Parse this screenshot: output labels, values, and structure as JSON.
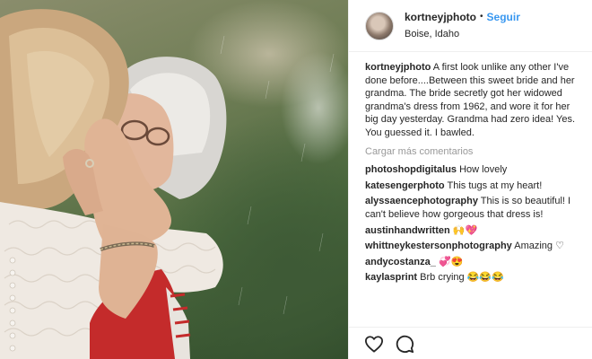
{
  "post": {
    "username": "kortneyjphoto",
    "separator": "•",
    "follow_label": "Seguir",
    "location": "Boise, Idaho",
    "caption_user": "kortneyjphoto",
    "caption_text": "A first look unlike any other I've done before....Between this sweet bride and her grandma. The bride secretly got her widowed grandma's dress from 1962, and wore it for her big day yesterday. Grandma had zero idea! Yes. You guessed it. I bawled.",
    "load_more_label": "Cargar más comentarios"
  },
  "comments": [
    {
      "user": "photoshopdigitalus",
      "text": "How lovely"
    },
    {
      "user": "katesengerphoto",
      "text": "This tugs at my heart!"
    },
    {
      "user": "alyssaencephotography",
      "text": "This is so beautiful! I can't believe how gorgeous that dress is!"
    },
    {
      "user": "austinhandwritten",
      "text": "🙌💖"
    },
    {
      "user": "whittneykestersonphotography",
      "text": "Amazing ♡"
    },
    {
      "user": "andycostanza_",
      "text": "💞😍"
    },
    {
      "user": "kaylasprint",
      "text": "Brb crying 😂😂😂"
    }
  ],
  "icons": {
    "like": "heart-icon",
    "comment": "comment-bubble-icon"
  },
  "colors": {
    "link": "#3897f0",
    "muted": "#999999",
    "text": "#262626"
  }
}
